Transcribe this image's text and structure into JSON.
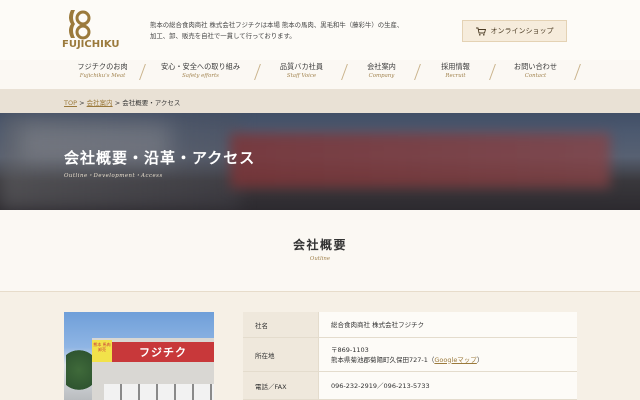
{
  "header": {
    "logo_text": "FUJICHIKU",
    "tagline_line1": "熊本の総合食肉商社 株式会社フジチクは本場 熊本の馬肉、黒毛和牛（藤彩牛）の生産、",
    "tagline_line2": "加工、卸、販売を自社で一貫して行っております。",
    "shop_button": "オンラインショップ"
  },
  "nav": {
    "items": [
      {
        "jp": "フジチクのお肉",
        "en": "Fujichiku's Meat"
      },
      {
        "jp": "安心・安全への取り組み",
        "en": "Safety efforts"
      },
      {
        "jp": "品質バカ社員",
        "en": "Staff Voice"
      },
      {
        "jp": "会社案内",
        "en": "Company"
      },
      {
        "jp": "採用情報",
        "en": "Recruit"
      },
      {
        "jp": "お問い合わせ",
        "en": "Contact"
      }
    ]
  },
  "breadcrumb": {
    "top": "TOP",
    "sep": ">",
    "company": "会社案内",
    "current": "会社概要・アクセス"
  },
  "hero": {
    "title": "会社概要・沿革・アクセス",
    "subtitle": "Outline・Development・Access"
  },
  "section": {
    "title": "会社概要",
    "subtitle": "Outline"
  },
  "photo": {
    "sign": "フジチク",
    "sub_sign": "熊本 馬肉 卸売"
  },
  "company_info": {
    "name_label": "社名",
    "name_value": "総合食肉商社 株式会社フジチク",
    "address_label": "所在地",
    "postal": "〒869-1103",
    "address": "熊本県菊池郡菊陽町久保田727-1",
    "map_link": "Googleマップ",
    "phone_label": "電話／FAX",
    "phone_value": "096-232-2919／096-213-5733"
  },
  "colors": {
    "accent_gold": "#9b7a3c",
    "nav_sub": "#a28450",
    "sign_red": "#c8383a"
  }
}
